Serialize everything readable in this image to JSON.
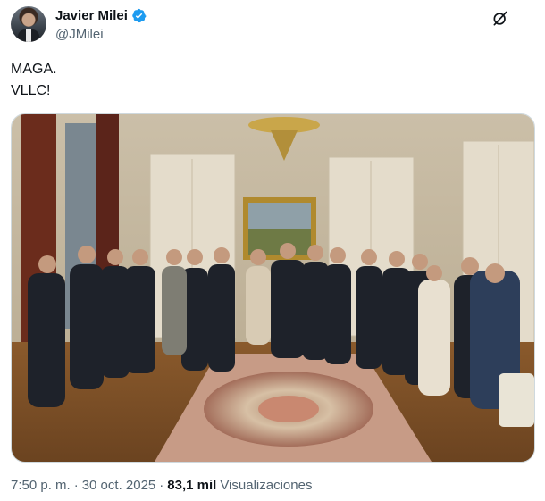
{
  "author": {
    "name": "Javier Milei",
    "handle": "@JMilei",
    "verified": true
  },
  "tweet": {
    "lines": [
      "MAGA.",
      "VLLC!"
    ]
  },
  "media": {
    "icon": "photo"
  },
  "meta": {
    "time": "7:50 p. m.",
    "date": "30 oct. 2025",
    "separator": "·",
    "views_count": "83,1 mil",
    "views_label": "Visualizaciones"
  },
  "colors": {
    "text": "#0f1419",
    "secondary": "#536471",
    "verified_blue": "#1d9bf0",
    "border": "#cfd9de"
  },
  "icons": {
    "verified": "verified-badge-icon",
    "grok": "grok-icon"
  }
}
